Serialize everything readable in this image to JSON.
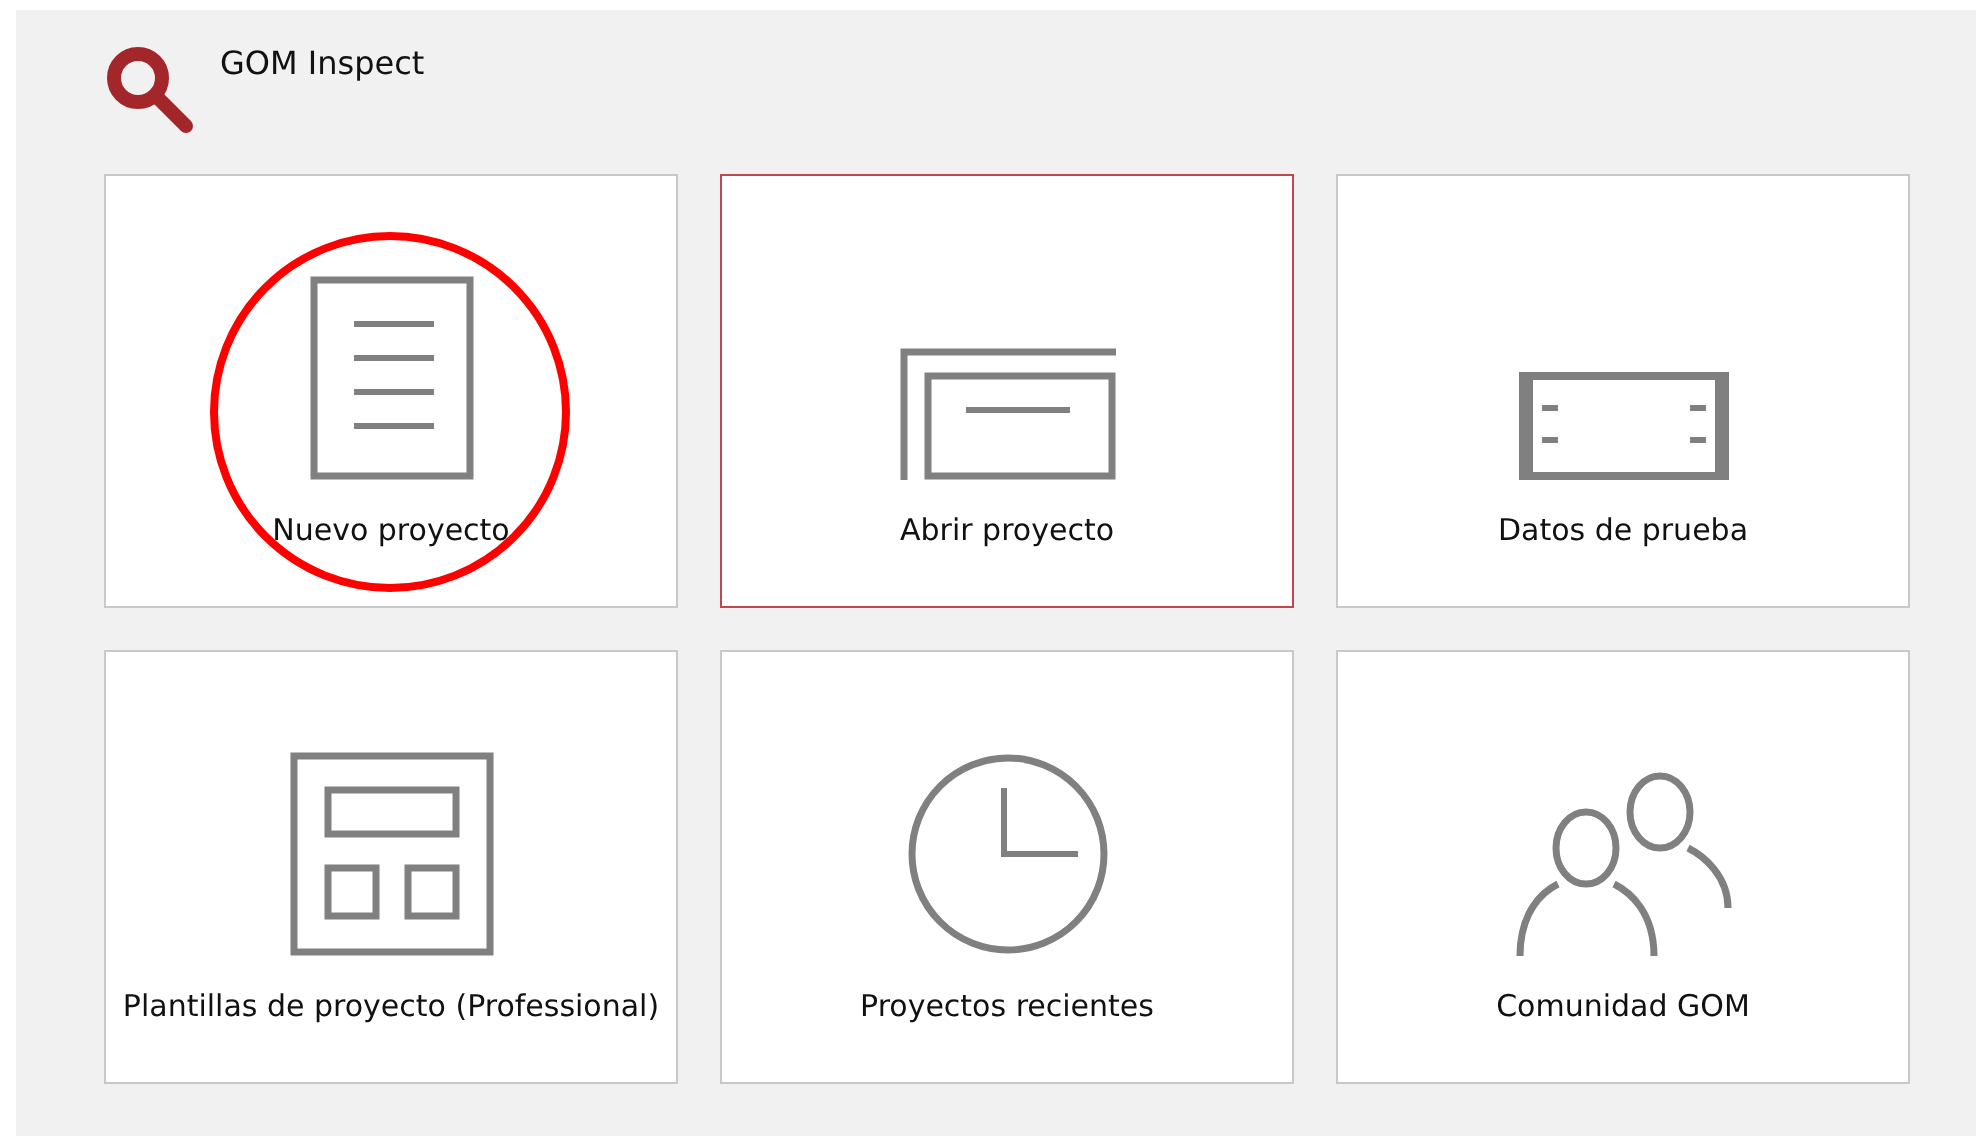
{
  "window": {
    "title": "GOM Inspect"
  },
  "tiles": [
    {
      "kind": "new",
      "label": "Nuevo proyecto",
      "selected": false,
      "circled": true
    },
    {
      "kind": "open",
      "label": "Abrir proyecto",
      "selected": true,
      "circled": false
    },
    {
      "kind": "data",
      "label": "Datos de prueba",
      "selected": false,
      "circled": false
    },
    {
      "kind": "templates",
      "label": "Plantillas de proyecto (Professional)",
      "selected": false,
      "circled": false
    },
    {
      "kind": "recent",
      "label": "Proyectos recientes",
      "selected": false,
      "circled": false
    },
    {
      "kind": "community",
      "label": "Comunidad GOM",
      "selected": false,
      "circled": false
    }
  ]
}
